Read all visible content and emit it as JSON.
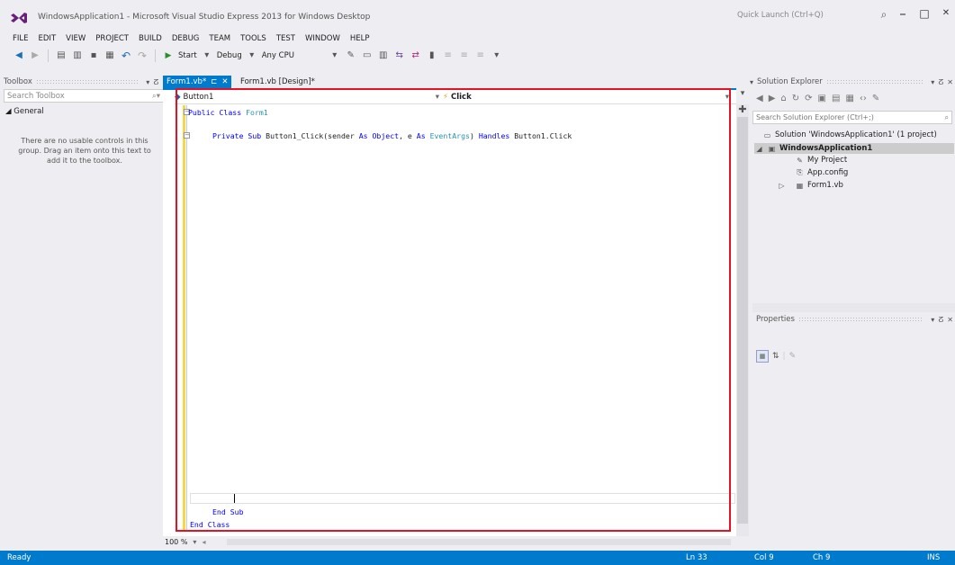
{
  "window": {
    "title": "WindowsApplication1 - Microsoft Visual Studio Express 2013 for Windows Desktop",
    "quick_launch_placeholder": "Quick Launch (Ctrl+Q)"
  },
  "menu": [
    "FILE",
    "EDIT",
    "VIEW",
    "PROJECT",
    "BUILD",
    "DEBUG",
    "TEAM",
    "TOOLS",
    "TEST",
    "WINDOW",
    "HELP"
  ],
  "toolbar": {
    "start_label": "Start",
    "config": "Debug",
    "platform": "Any CPU"
  },
  "toolbox": {
    "title": "Toolbox",
    "search_placeholder": "Search Toolbox",
    "group": "General",
    "empty_message": "There are no usable controls in this group. Drag an item onto this text to add it to the toolbox."
  },
  "tabs": [
    {
      "label": "Form1.vb*",
      "active": true
    },
    {
      "label": "Form1.vb [Design]*",
      "active": false
    }
  ],
  "editor": {
    "nav_object": "Button1",
    "nav_event": "Click",
    "zoom": "100 %",
    "code": {
      "line1_kw": "Public Class",
      "line1_type": "Form1",
      "line2_a": "Private Sub",
      "line2_b": " Button1_Click(sender ",
      "line2_c": "As Object",
      "line2_d": ", e ",
      "line2_e": "As",
      "line2_f": "EventArgs",
      "line2_g": ") ",
      "line2_h": "Handles",
      "line2_i": " Button1.Click",
      "line3": "End Sub",
      "line4": "End Class"
    }
  },
  "solution_explorer": {
    "title": "Solution Explorer",
    "search_placeholder": "Search Solution Explorer (Ctrl+;)",
    "solution": "Solution 'WindowsApplication1' (1 project)",
    "project": "WindowsApplication1",
    "items": [
      "My Project",
      "App.config",
      "Form1.vb"
    ]
  },
  "properties": {
    "title": "Properties"
  },
  "status": {
    "text": "Ready",
    "line": "Ln 33",
    "col": "Col 9",
    "ch": "Ch 9",
    "mode": "INS"
  },
  "colors": {
    "accent": "#007acc",
    "highlight": "#e81123",
    "keyword": "#0000ff",
    "type": "#2b91af"
  }
}
